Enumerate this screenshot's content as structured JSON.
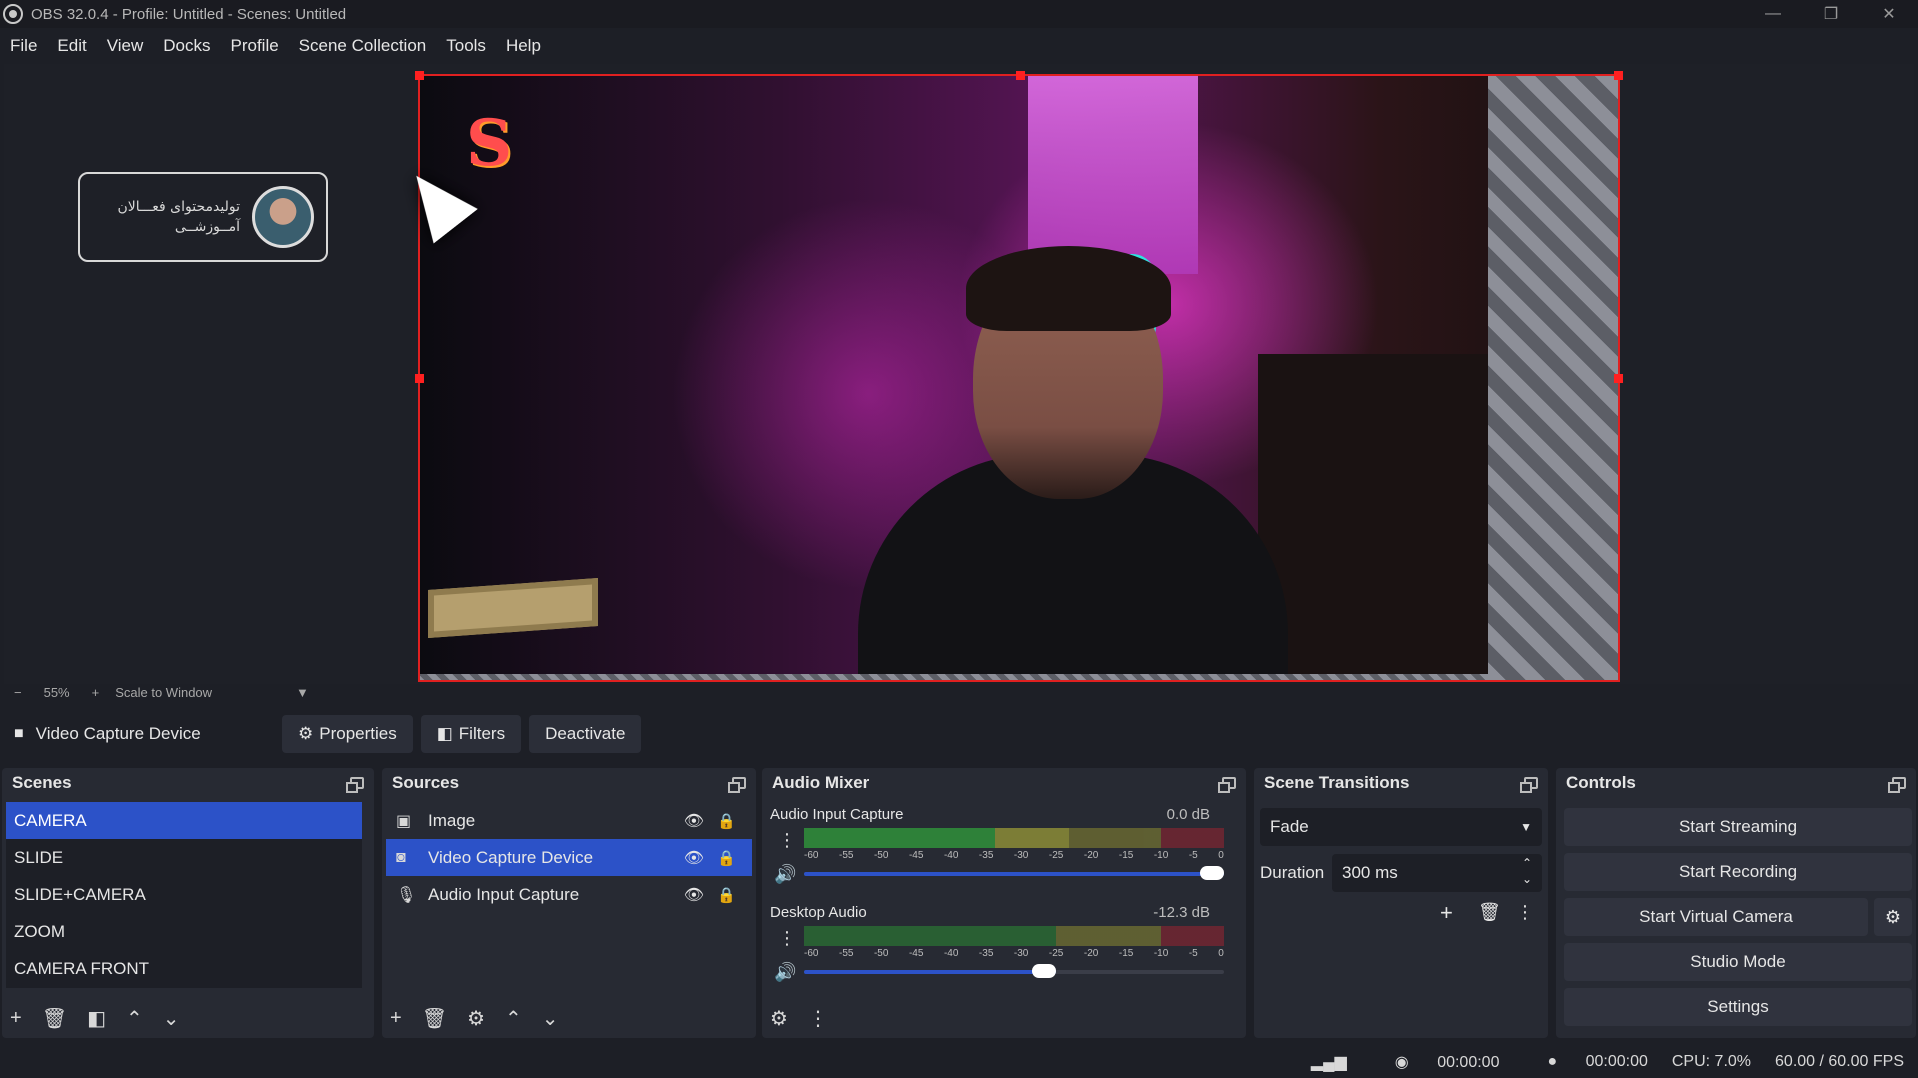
{
  "window": {
    "title": "OBS 32.0.4 - Profile: Untitled - Scenes: Untitled",
    "minimize": "—",
    "maximize": "❐",
    "close": "✕"
  },
  "menu": [
    "File",
    "Edit",
    "View",
    "Docks",
    "Profile",
    "Scene Collection",
    "Tools",
    "Help"
  ],
  "preview": {
    "overlay_line1": "تولیدمحتوای فعـــالان",
    "overlay_line2": "آمــوزشــی",
    "zoom_minus": "−",
    "zoom_value": "55%",
    "zoom_plus": "+",
    "scale_mode": "Scale to Window"
  },
  "source_toolbar": {
    "selected_source": "Video Capture Device",
    "properties": "Properties",
    "filters": "Filters",
    "deactivate": "Deactivate"
  },
  "scenes": {
    "title": "Scenes",
    "items": [
      "CAMERA",
      "SLIDE",
      "SLIDE+CAMERA",
      "ZOOM",
      "CAMERA FRONT"
    ],
    "selected": "CAMERA"
  },
  "sources": {
    "title": "Sources",
    "items": [
      {
        "label": "Image",
        "icon": "image-icon"
      },
      {
        "label": "Video Capture Device",
        "icon": "camera-icon"
      },
      {
        "label": "Audio Input Capture",
        "icon": "microphone-icon"
      }
    ],
    "selected": "Video Capture Device"
  },
  "audio_mixer": {
    "title": "Audio Mixer",
    "ticks": [
      "-60",
      "-55",
      "-50",
      "-45",
      "-40",
      "-35",
      "-30",
      "-25",
      "-20",
      "-15",
      "-10",
      "-5",
      "0"
    ],
    "channels": [
      {
        "name": "Audio Input Capture",
        "db": "0.0 dB",
        "volume_fraction": 1.0,
        "level_fraction": 0.63
      },
      {
        "name": "Desktop Audio",
        "db": "-12.3 dB",
        "volume_fraction": 0.6,
        "level_fraction": 0.0
      }
    ]
  },
  "scene_transitions": {
    "title": "Scene Transitions",
    "transition": "Fade",
    "duration_label": "Duration",
    "duration_value": "300 ms"
  },
  "controls": {
    "title": "Controls",
    "start_streaming": "Start Streaming",
    "start_recording": "Start Recording",
    "start_virtual_camera": "Start Virtual Camera",
    "studio_mode": "Studio Mode",
    "settings": "Settings"
  },
  "status": {
    "stream_time": "00:00:00",
    "record_time": "00:00:00",
    "cpu": "CPU: 7.0%",
    "fps": "60.00 / 60.00 FPS"
  },
  "colors": {
    "accent": "#2c52c8",
    "selection_border": "#e02020"
  }
}
